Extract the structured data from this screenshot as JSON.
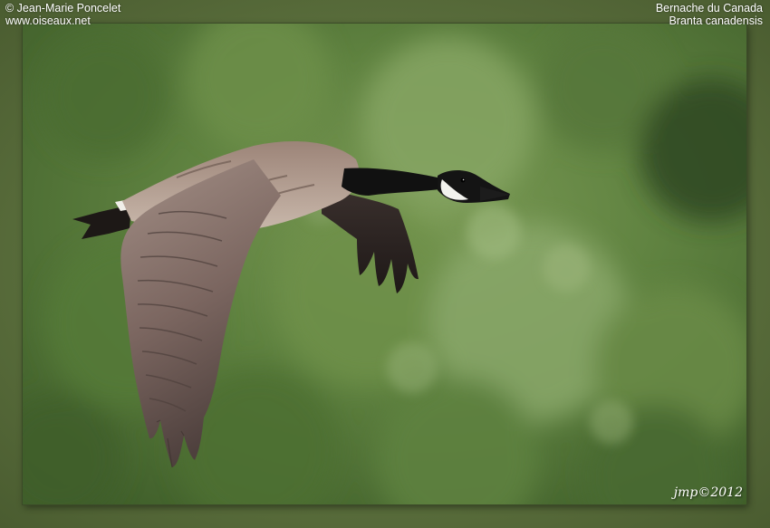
{
  "credits": {
    "photographer": "© Jean-Marie Poncelet",
    "website": "www.oiseaux.net"
  },
  "species": {
    "common_name": "Bernache du Canada",
    "scientific_name": "Branta canadensis"
  },
  "signature": "jmp©2012",
  "colors": {
    "background_green": "#5b7a3a",
    "frame_green": "#5d7140",
    "goose_body_brown": "#8a7468",
    "goose_neck_black": "#111111",
    "cheek_white": "#f2f2ee"
  }
}
